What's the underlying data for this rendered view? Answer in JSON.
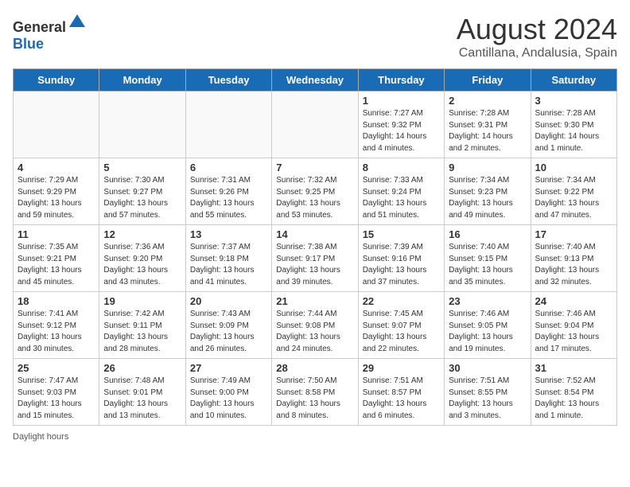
{
  "header": {
    "logo_general": "General",
    "logo_blue": "Blue",
    "month_year": "August 2024",
    "location": "Cantillana, Andalusia, Spain"
  },
  "days_of_week": [
    "Sunday",
    "Monday",
    "Tuesday",
    "Wednesday",
    "Thursday",
    "Friday",
    "Saturday"
  ],
  "weeks": [
    [
      {
        "day": "",
        "info": ""
      },
      {
        "day": "",
        "info": ""
      },
      {
        "day": "",
        "info": ""
      },
      {
        "day": "",
        "info": ""
      },
      {
        "day": "1",
        "info": "Sunrise: 7:27 AM\nSunset: 9:32 PM\nDaylight: 14 hours\nand 4 minutes."
      },
      {
        "day": "2",
        "info": "Sunrise: 7:28 AM\nSunset: 9:31 PM\nDaylight: 14 hours\nand 2 minutes."
      },
      {
        "day": "3",
        "info": "Sunrise: 7:28 AM\nSunset: 9:30 PM\nDaylight: 14 hours\nand 1 minute."
      }
    ],
    [
      {
        "day": "4",
        "info": "Sunrise: 7:29 AM\nSunset: 9:29 PM\nDaylight: 13 hours\nand 59 minutes."
      },
      {
        "day": "5",
        "info": "Sunrise: 7:30 AM\nSunset: 9:27 PM\nDaylight: 13 hours\nand 57 minutes."
      },
      {
        "day": "6",
        "info": "Sunrise: 7:31 AM\nSunset: 9:26 PM\nDaylight: 13 hours\nand 55 minutes."
      },
      {
        "day": "7",
        "info": "Sunrise: 7:32 AM\nSunset: 9:25 PM\nDaylight: 13 hours\nand 53 minutes."
      },
      {
        "day": "8",
        "info": "Sunrise: 7:33 AM\nSunset: 9:24 PM\nDaylight: 13 hours\nand 51 minutes."
      },
      {
        "day": "9",
        "info": "Sunrise: 7:34 AM\nSunset: 9:23 PM\nDaylight: 13 hours\nand 49 minutes."
      },
      {
        "day": "10",
        "info": "Sunrise: 7:34 AM\nSunset: 9:22 PM\nDaylight: 13 hours\nand 47 minutes."
      }
    ],
    [
      {
        "day": "11",
        "info": "Sunrise: 7:35 AM\nSunset: 9:21 PM\nDaylight: 13 hours\nand 45 minutes."
      },
      {
        "day": "12",
        "info": "Sunrise: 7:36 AM\nSunset: 9:20 PM\nDaylight: 13 hours\nand 43 minutes."
      },
      {
        "day": "13",
        "info": "Sunrise: 7:37 AM\nSunset: 9:18 PM\nDaylight: 13 hours\nand 41 minutes."
      },
      {
        "day": "14",
        "info": "Sunrise: 7:38 AM\nSunset: 9:17 PM\nDaylight: 13 hours\nand 39 minutes."
      },
      {
        "day": "15",
        "info": "Sunrise: 7:39 AM\nSunset: 9:16 PM\nDaylight: 13 hours\nand 37 minutes."
      },
      {
        "day": "16",
        "info": "Sunrise: 7:40 AM\nSunset: 9:15 PM\nDaylight: 13 hours\nand 35 minutes."
      },
      {
        "day": "17",
        "info": "Sunrise: 7:40 AM\nSunset: 9:13 PM\nDaylight: 13 hours\nand 32 minutes."
      }
    ],
    [
      {
        "day": "18",
        "info": "Sunrise: 7:41 AM\nSunset: 9:12 PM\nDaylight: 13 hours\nand 30 minutes."
      },
      {
        "day": "19",
        "info": "Sunrise: 7:42 AM\nSunset: 9:11 PM\nDaylight: 13 hours\nand 28 minutes."
      },
      {
        "day": "20",
        "info": "Sunrise: 7:43 AM\nSunset: 9:09 PM\nDaylight: 13 hours\nand 26 minutes."
      },
      {
        "day": "21",
        "info": "Sunrise: 7:44 AM\nSunset: 9:08 PM\nDaylight: 13 hours\nand 24 minutes."
      },
      {
        "day": "22",
        "info": "Sunrise: 7:45 AM\nSunset: 9:07 PM\nDaylight: 13 hours\nand 22 minutes."
      },
      {
        "day": "23",
        "info": "Sunrise: 7:46 AM\nSunset: 9:05 PM\nDaylight: 13 hours\nand 19 minutes."
      },
      {
        "day": "24",
        "info": "Sunrise: 7:46 AM\nSunset: 9:04 PM\nDaylight: 13 hours\nand 17 minutes."
      }
    ],
    [
      {
        "day": "25",
        "info": "Sunrise: 7:47 AM\nSunset: 9:03 PM\nDaylight: 13 hours\nand 15 minutes."
      },
      {
        "day": "26",
        "info": "Sunrise: 7:48 AM\nSunset: 9:01 PM\nDaylight: 13 hours\nand 13 minutes."
      },
      {
        "day": "27",
        "info": "Sunrise: 7:49 AM\nSunset: 9:00 PM\nDaylight: 13 hours\nand 10 minutes."
      },
      {
        "day": "28",
        "info": "Sunrise: 7:50 AM\nSunset: 8:58 PM\nDaylight: 13 hours\nand 8 minutes."
      },
      {
        "day": "29",
        "info": "Sunrise: 7:51 AM\nSunset: 8:57 PM\nDaylight: 13 hours\nand 6 minutes."
      },
      {
        "day": "30",
        "info": "Sunrise: 7:51 AM\nSunset: 8:55 PM\nDaylight: 13 hours\nand 3 minutes."
      },
      {
        "day": "31",
        "info": "Sunrise: 7:52 AM\nSunset: 8:54 PM\nDaylight: 13 hours\nand 1 minute."
      }
    ]
  ],
  "footer": {
    "daylight_label": "Daylight hours"
  }
}
